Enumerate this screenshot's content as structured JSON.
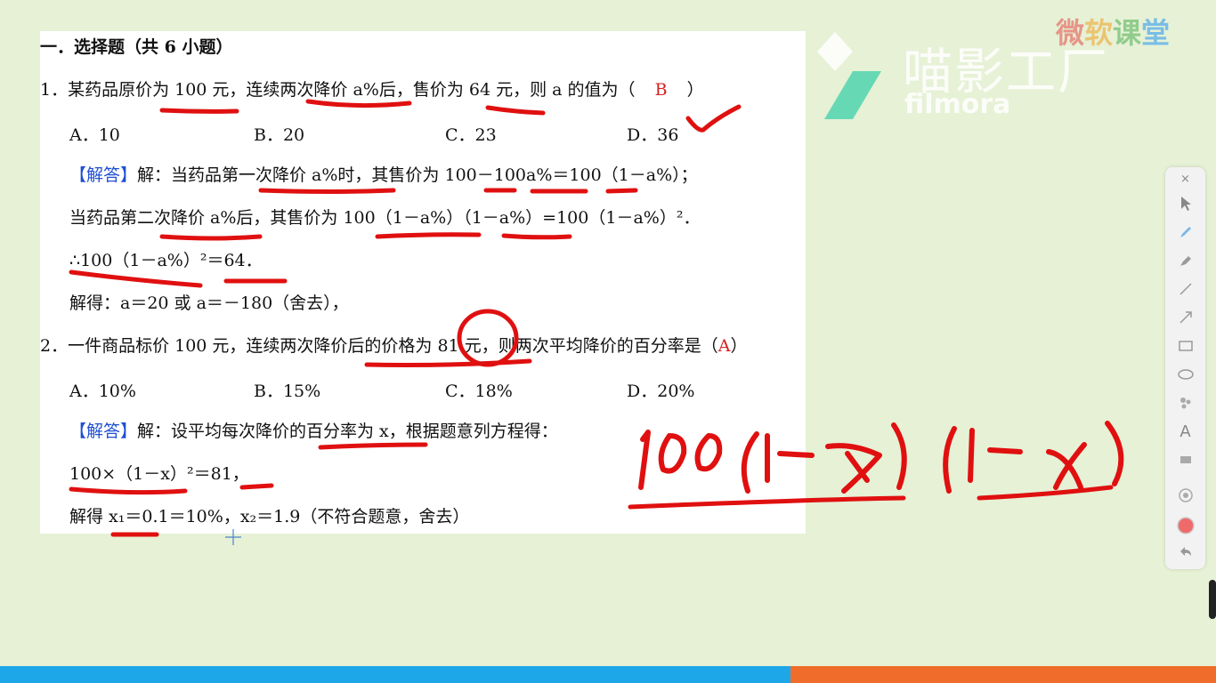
{
  "document": {
    "heading": "一．选择题（共 6 小题）",
    "q1": {
      "stem": "1．某药品原价为 100 元，连续两次降价 a%后，售价为 64 元，则 a 的值为（",
      "answer": "B",
      "close": "）",
      "options": [
        "A．10",
        "B．20",
        "C．23",
        "D．36"
      ],
      "solution_tag": "【解答】",
      "solution_lines": [
        "解：当药品第一次降价 a%时，其售价为 100－100a%＝100（1－a%）；",
        "当药品第二次降价 a%后，其售价为 100（1－a%）（1－a%）=100（1－a%）²．",
        "∴100（1－a%）²＝64．",
        "解得：a＝20 或 a＝－180（舍去），"
      ]
    },
    "q2": {
      "stem": "2．一件商品标价 100 元，连续两次降价后的价格为 81 元，则两次平均降价的百分率是（",
      "answer": "A",
      "close": "）",
      "options": [
        "A．10%",
        "B．15%",
        "C．18%",
        "D．20%"
      ],
      "solution_tag": "【解答】",
      "solution_lines": [
        "解：设平均每次降价的百分率为 x，根据题意列方程得：",
        "100×（1－x）²＝81，",
        "解得 x₁＝0.1＝10%，x₂＝1.9（不符合题意，舍去）"
      ]
    }
  },
  "handwriting": "100(1-x)(1-x)",
  "watermark": {
    "cn": "喵影工厂",
    "en": "filmora"
  },
  "brand": "微软课堂",
  "toolbar": {
    "close": "×",
    "tools": [
      "pointer-icon",
      "pen-icon",
      "highlighter-icon",
      "line-icon",
      "arrow-icon",
      "rectangle-icon",
      "ellipse-icon",
      "shapes-icon",
      "text-icon",
      "eraser-icon",
      "dot-icon",
      "color-icon",
      "undo-icon"
    ],
    "text_tool_glyph": "A"
  },
  "colors": {
    "ink": "#e01010",
    "answer": "#d62020",
    "tag": "#1f4fd6",
    "background": "#e6f1d6"
  }
}
